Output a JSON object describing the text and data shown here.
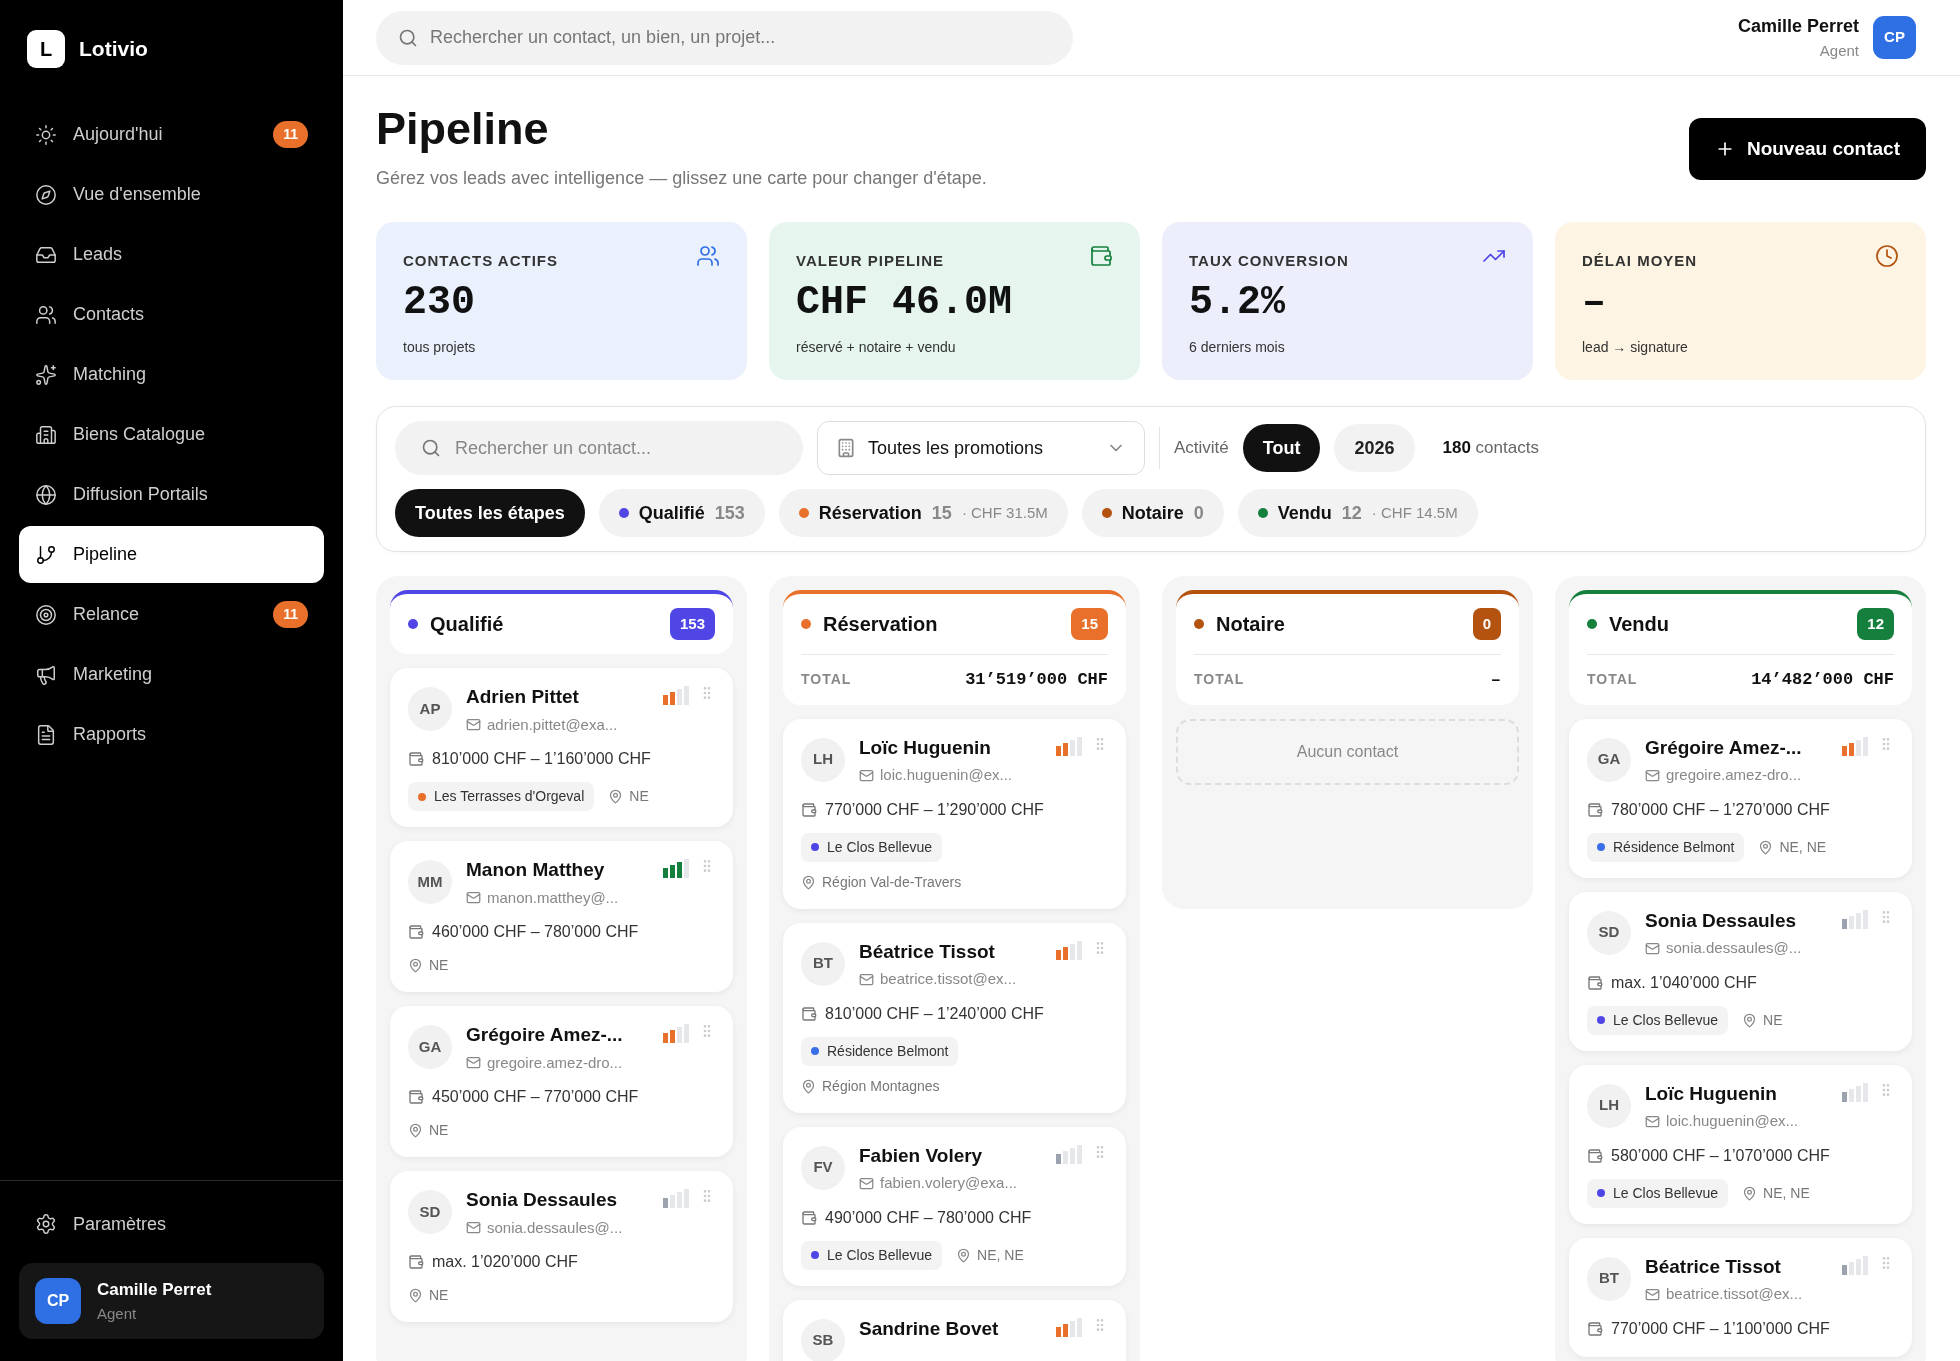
{
  "brand": {
    "initial": "L",
    "name": "Lotivio"
  },
  "nav": [
    {
      "label": "Aujourd'hui",
      "kind": "sun",
      "badge": "11",
      "selected": false
    },
    {
      "label": "Vue d'ensemble",
      "kind": "compass",
      "selected": false
    },
    {
      "label": "Leads",
      "kind": "inbox",
      "selected": false
    },
    {
      "label": "Contacts",
      "kind": "users",
      "selected": false
    },
    {
      "label": "Matching",
      "kind": "sparkles",
      "selected": false
    },
    {
      "label": "Biens Catalogue",
      "kind": "building",
      "selected": false
    },
    {
      "label": "Diffusion Portails",
      "kind": "globe",
      "selected": false
    },
    {
      "label": "Pipeline",
      "kind": "branch",
      "selected": true
    },
    {
      "label": "Relance",
      "kind": "target",
      "badge": "11",
      "selected": false
    },
    {
      "label": "Marketing",
      "kind": "megaphone",
      "selected": false
    },
    {
      "label": "Rapports",
      "kind": "file",
      "selected": false
    }
  ],
  "settings": {
    "label": "Paramètres"
  },
  "sidebar_user": {
    "initials": "CP",
    "name": "Camille Perret",
    "role": "Agent"
  },
  "topbar": {
    "search_placeholder": "Rechercher un contact, un bien, un projet...",
    "user": {
      "name": "Camille Perret",
      "role": "Agent",
      "initials": "CP"
    }
  },
  "page": {
    "title": "Pipeline",
    "subtitle": "Gérez vos leads avec intelligence — glissez une carte pour changer d'étape.",
    "new_button": "Nouveau contact"
  },
  "stats": [
    {
      "kind": "contacts",
      "label": "CONTACTS ACTIFS",
      "value": "230",
      "note": "tous projets"
    },
    {
      "kind": "value",
      "label": "VALEUR PIPELINE",
      "value": "CHF 46.0M",
      "note": "réservé + notaire + vendu"
    },
    {
      "kind": "conversion",
      "label": "TAUX CONVERSION",
      "value": "5.2%",
      "note": "6 derniers mois"
    },
    {
      "kind": "delay",
      "label": "DÉLAI MOYEN",
      "value": "–",
      "note": "lead → signature"
    }
  ],
  "filters": {
    "search_placeholder": "Rechercher un contact...",
    "promotion": "Toutes les promotions",
    "activity_label": "Activité",
    "activity": [
      {
        "label": "Tout",
        "selected": true
      },
      {
        "label": "2026",
        "selected": false
      }
    ],
    "count": {
      "number": "180",
      "label": "contacts"
    },
    "stages": [
      {
        "label": "Toutes les étapes",
        "selected": true
      },
      {
        "label": "Qualifié",
        "count": "153",
        "color": "#4f46e5",
        "selected": false
      },
      {
        "label": "Réservation",
        "count": "15",
        "amount": "· CHF 31.5M",
        "color": "#e8702a",
        "selected": false
      },
      {
        "label": "Notaire",
        "count": "0",
        "color": "#b4530f",
        "selected": false
      },
      {
        "label": "Vendu",
        "count": "12",
        "amount": "· CHF 14.5M",
        "color": "#15803d",
        "selected": false
      }
    ]
  },
  "columns": [
    {
      "title": "Qualifié",
      "color": "#4f46e5",
      "count": "153",
      "cards": [
        {
          "initials": "AP",
          "name": "Adrien Pittet",
          "email": "adrien.pittet@exa...",
          "budget": "810’000 CHF – 1’160’000 CHF",
          "project": {
            "label": "Les Terrasses d'Orgeval",
            "color": "#e8702a"
          },
          "location": "NE",
          "score": {
            "level": 0.5,
            "color": "#e8702a"
          }
        },
        {
          "initials": "MM",
          "name": "Manon Matthey",
          "email": "manon.matthey@...",
          "budget": "460’000 CHF – 780’000 CHF",
          "location": "NE",
          "score": {
            "level": 0.75,
            "color": "#15803d"
          }
        },
        {
          "initials": "GA",
          "name": "Grégoire Amez-...",
          "email": "gregoire.amez-dro...",
          "budget": "450’000 CHF – 770’000 CHF",
          "location": "NE",
          "score": {
            "level": 0.5,
            "color": "#e8702a"
          }
        },
        {
          "initials": "SD",
          "name": "Sonia Dessaules",
          "email": "sonia.dessaules@...",
          "budget": "max. 1’020’000 CHF",
          "location": "NE",
          "score": {
            "level": 0.25
          }
        }
      ]
    },
    {
      "title": "Réservation",
      "color": "#e8702a",
      "count": "15",
      "total_label": "TOTAL",
      "total": "31’519’000 CHF",
      "cards": [
        {
          "initials": "LH",
          "name": "Loïc Huguenin",
          "email": "loic.huguenin@ex...",
          "budget": "770’000 CHF – 1’290’000 CHF",
          "project": {
            "label": "Le Clos Bellevue",
            "color": "#4f46e5"
          },
          "location": "Région Val-de-Travers",
          "score": {
            "level": 0.5,
            "color": "#e8702a"
          }
        },
        {
          "initials": "BT",
          "name": "Béatrice Tissot",
          "email": "beatrice.tissot@ex...",
          "budget": "810’000 CHF – 1’240’000 CHF",
          "project": {
            "label": "Résidence Belmont",
            "color": "#3b6fe8"
          },
          "location": "Région Montagnes",
          "score": {
            "level": 0.5,
            "color": "#e8702a"
          }
        },
        {
          "initials": "FV",
          "name": "Fabien Volery",
          "email": "fabien.volery@exa...",
          "budget": "490’000 CHF – 780’000 CHF",
          "project": {
            "label": "Le Clos Bellevue",
            "color": "#4f46e5"
          },
          "location": "NE, NE",
          "score": {
            "level": 0.25
          }
        },
        {
          "initials": "SB",
          "name": "Sandrine Bovet",
          "score": {
            "level": 0.5,
            "color": "#e8702a"
          }
        }
      ]
    },
    {
      "title": "Notaire",
      "color": "#b4530f",
      "count": "0",
      "total_label": "TOTAL",
      "total": "–",
      "empty": "Aucun contact"
    },
    {
      "title": "Vendu",
      "color": "#15803d",
      "count": "12",
      "total_label": "TOTAL",
      "total": "14’482’000 CHF",
      "cards": [
        {
          "initials": "GA",
          "name": "Grégoire Amez-...",
          "email": "gregoire.amez-dro...",
          "budget": "780’000 CHF – 1’270’000 CHF",
          "project": {
            "label": "Résidence Belmont",
            "color": "#3b6fe8"
          },
          "location": "NE, NE",
          "score": {
            "level": 0.5,
            "color": "#e8702a"
          }
        },
        {
          "initials": "SD",
          "name": "Sonia Dessaules",
          "email": "sonia.dessaules@...",
          "budget": "max. 1’040’000 CHF",
          "project": {
            "label": "Le Clos Bellevue",
            "color": "#4f46e5"
          },
          "location": "NE",
          "score": {
            "level": 0.25
          }
        },
        {
          "initials": "LH",
          "name": "Loïc Huguenin",
          "email": "loic.huguenin@ex...",
          "budget": "580’000 CHF – 1’070’000 CHF",
          "project": {
            "label": "Le Clos Bellevue",
            "color": "#4f46e5"
          },
          "location": "NE, NE",
          "score": {
            "level": 0.25
          }
        },
        {
          "initials": "BT",
          "name": "Béatrice Tissot",
          "email": "beatrice.tissot@ex...",
          "budget": "770’000 CHF – 1’100’000 CHF",
          "score": {
            "level": 0.25
          }
        }
      ]
    }
  ]
}
